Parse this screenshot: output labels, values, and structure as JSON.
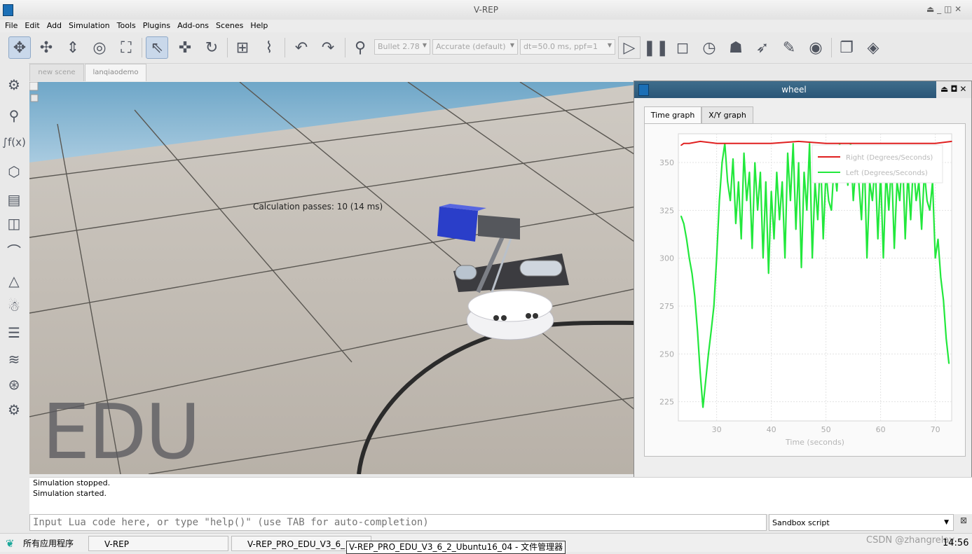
{
  "window": {
    "title": "V-REP",
    "controls": "⏏ _ ◫ ✕"
  },
  "menu": [
    "File",
    "Edit",
    "Add",
    "Simulation",
    "Tools",
    "Plugins",
    "Add-ons",
    "Scenes",
    "Help"
  ],
  "toolbar": {
    "engine": "Bullet 2.78",
    "accuracy": "Accurate (default)",
    "timestep": "dt=50.0 ms, ppf=1",
    "icons": [
      "camera-pan-icon",
      "camera-rotate-icon",
      "camera-shift-icon",
      "camera-angle-icon",
      "fit-to-view-icon",
      "object-select-icon",
      "object-translate-icon",
      "object-rotate-icon",
      "assemble-icon",
      "path-edit-icon",
      "undo-icon",
      "redo-icon",
      "dynamics-icon",
      "start-simulation-icon",
      "pause-simulation-icon",
      "stop-simulation-icon",
      "real-time-icon",
      "slow-down-icon",
      "speed-up-icon",
      "thread-rendering-icon",
      "visualization-icon",
      "page-selector-icon",
      "view-selector-icon"
    ]
  },
  "left_toolbar": [
    "simulation-settings-icon",
    "calculation-modules-icon",
    "scripts-icon",
    "shape-edit-icon",
    "layers-icon",
    "scene-hierarchy-icon",
    "path-icon",
    "selection-icon",
    "model-browser-icon",
    "ik-icon",
    "layers-list-icon",
    "video-recorder-icon",
    "user-settings-icon"
  ],
  "scene_tabs": [
    "new scene",
    "lanqiaodemo"
  ],
  "viewport": {
    "calc_text": "Calculation passes: 10 (14 ms)",
    "watermark": "EDU"
  },
  "graph_window": {
    "title": "wheel",
    "controls": "⏏◘✕",
    "tabs": [
      "Time graph",
      "X/Y graph"
    ],
    "active_tab": "Time graph"
  },
  "chart_data": {
    "type": "line",
    "xlabel": "Time (seconds)",
    "xlim": [
      23,
      73
    ],
    "ylim": [
      215,
      365
    ],
    "x_ticks": [
      30,
      40,
      50,
      60,
      70
    ],
    "y_ticks": [
      225,
      250,
      275,
      300,
      325,
      350
    ],
    "grid": true,
    "legend_position": "top-right",
    "series": [
      {
        "name": "Right (Degrees/Seconds)",
        "color": "#e02020",
        "x": [
          23.5,
          24,
          25,
          27,
          30,
          35,
          40,
          45,
          50,
          55,
          60,
          65,
          70,
          73
        ],
        "y": [
          359,
          360,
          360,
          361,
          360,
          360,
          360,
          361,
          360,
          360,
          360,
          360,
          360,
          361
        ]
      },
      {
        "name": "Left (Degrees/Seconds)",
        "color": "#22e83c",
        "x": [
          23.5,
          24,
          24.5,
          25,
          25.5,
          26,
          26.5,
          27,
          27.5,
          28,
          28.5,
          29,
          29.5,
          30,
          30.5,
          31,
          31.5,
          32,
          32.5,
          33,
          33.5,
          34,
          34.5,
          35,
          35.5,
          36,
          36.5,
          37,
          37.5,
          38,
          38.5,
          39,
          39.5,
          40,
          40.5,
          41,
          41.5,
          42,
          42.5,
          43,
          43.5,
          44,
          44.5,
          45,
          45.5,
          46,
          46.5,
          47,
          47.5,
          48,
          48.5,
          49,
          49.5,
          50,
          50.5,
          51,
          51.5,
          52,
          52.5,
          53,
          53.5,
          54,
          54.5,
          55,
          55.5,
          56,
          56.5,
          57,
          57.5,
          58,
          58.5,
          59,
          59.5,
          60,
          60.5,
          61,
          61.5,
          62,
          62.5,
          63,
          63.5,
          64,
          64.5,
          65,
          65.5,
          66,
          66.5,
          67,
          67.5,
          68,
          68.5,
          69,
          69.5,
          70,
          70.5,
          71,
          71.5,
          72,
          72.5
        ],
        "y": [
          322,
          318,
          310,
          300,
          292,
          280,
          262,
          240,
          222,
          236,
          250,
          262,
          275,
          300,
          330,
          350,
          360,
          340,
          330,
          352,
          318,
          340,
          310,
          355,
          330,
          345,
          305,
          350,
          325,
          345,
          300,
          340,
          292,
          335,
          310,
          345,
          320,
          340,
          300,
          355,
          330,
          360,
          315,
          350,
          295,
          345,
          325,
          360,
          300,
          340,
          320,
          355,
          310,
          345,
          330,
          325,
          350,
          335,
          360,
          345,
          355,
          338,
          360,
          330,
          350,
          340,
          320,
          355,
          300,
          340,
          330,
          350,
          310,
          345,
          300,
          345,
          325,
          350,
          305,
          340,
          330,
          355,
          310,
          345,
          320,
          350,
          330,
          340,
          315,
          345,
          330,
          325,
          340,
          300,
          310,
          290,
          278,
          258,
          245
        ]
      }
    ]
  },
  "console": {
    "lines": [
      "Simulation stopped.",
      "Simulation started."
    ]
  },
  "lua_input": {
    "placeholder": "Input Lua code here, or type \"help()\" (use TAB for auto-completion)"
  },
  "script_select": {
    "value": "Sandbox script",
    "close": "⊠"
  },
  "taskbar": {
    "start": "所有应用程序",
    "item1": "V-REP",
    "item2": "V-REP_PRO_EDU_V3_6_",
    "tooltip": "V-REP_PRO_EDU_V3_6_2_Ubuntu16_04 - 文件管理器",
    "watermark": "CSDN @zhangrelay",
    "clock": "14:56"
  }
}
